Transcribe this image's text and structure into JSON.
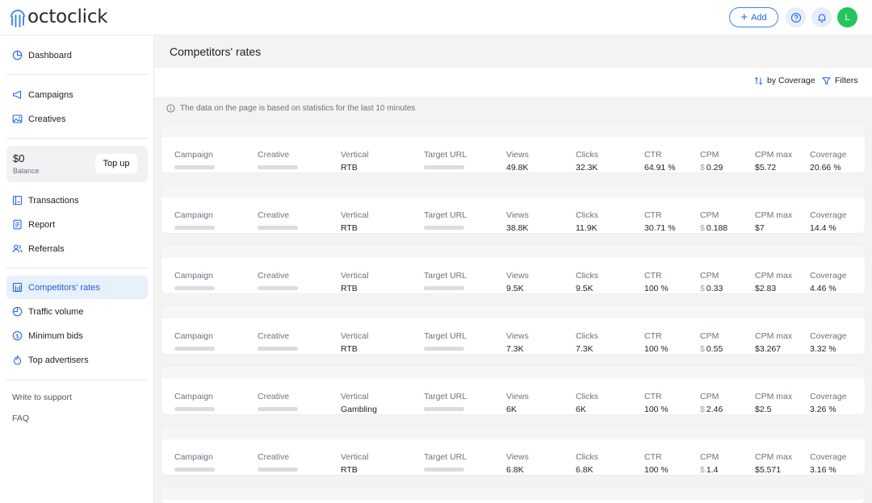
{
  "app": {
    "brand": "octoclick",
    "add_label": "Add",
    "avatar_initial": "L",
    "accent_color": "#2563eb"
  },
  "sidebar": {
    "dashboard": "Dashboard",
    "campaigns": "Campaigns",
    "creatives": "Creatives",
    "balance_amount": "$0",
    "balance_label": "Balance",
    "topup_label": "Top up",
    "transactions": "Transactions",
    "report": "Report",
    "referrals": "Referrals",
    "competitors_rates": "Competitors' rates",
    "traffic_volume": "Traffic volume",
    "minimum_bids": "Minimum bids",
    "top_advertisers": "Top advertisers",
    "write_to_support": "Write to support",
    "faq": "FAQ"
  },
  "main": {
    "title": "Competitors' rates",
    "sort_label": "by Coverage",
    "filters_label": "Filters",
    "info_text": "The data on the page is based on statistics for the last 10 minutes"
  },
  "columns": {
    "campaign": "Campaign",
    "creative": "Creative",
    "vertical": "Vertical",
    "target_url": "Target URL",
    "views": "Views",
    "clicks": "Clicks",
    "ctr": "CTR",
    "cpm": "CPM",
    "cpm_max": "CPM max",
    "coverage": "Coverage"
  },
  "currency_symbol": "$",
  "rows": [
    {
      "vertical": "RTB",
      "views": "49.8K",
      "clicks": "32.3K",
      "ctr": "64.91 %",
      "cpm": "0.29",
      "cpm_max": "$5.72",
      "coverage": "20.66 %"
    },
    {
      "vertical": "RTB",
      "views": "38.8K",
      "clicks": "11.9K",
      "ctr": "30.71 %",
      "cpm": "0.188",
      "cpm_max": "$7",
      "coverage": "14.4 %"
    },
    {
      "vertical": "RTB",
      "views": "9.5K",
      "clicks": "9.5K",
      "ctr": "100 %",
      "cpm": "0.33",
      "cpm_max": "$2.83",
      "coverage": "4.46 %"
    },
    {
      "vertical": "RTB",
      "views": "7.3K",
      "clicks": "7.3K",
      "ctr": "100 %",
      "cpm": "0.55",
      "cpm_max": "$3.267",
      "coverage": "3.32 %"
    },
    {
      "vertical": "Gambling",
      "views": "6K",
      "clicks": "6K",
      "ctr": "100 %",
      "cpm": "2.46",
      "cpm_max": "$2.5",
      "coverage": "3.26 %"
    },
    {
      "vertical": "RTB",
      "views": "6.8K",
      "clicks": "6.8K",
      "ctr": "100 %",
      "cpm": "1.4",
      "cpm_max": "$5.571",
      "coverage": "3.16 %"
    }
  ]
}
